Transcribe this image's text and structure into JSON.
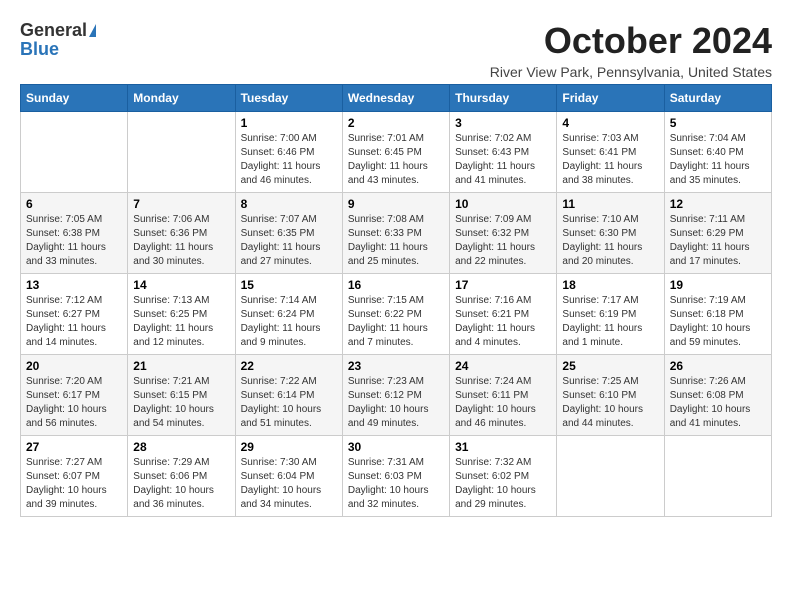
{
  "logo": {
    "general": "General",
    "blue": "Blue"
  },
  "title": "October 2024",
  "location": "River View Park, Pennsylvania, United States",
  "days_of_week": [
    "Sunday",
    "Monday",
    "Tuesday",
    "Wednesday",
    "Thursday",
    "Friday",
    "Saturday"
  ],
  "weeks": [
    [
      {
        "day": "",
        "sunrise": "",
        "sunset": "",
        "daylight": ""
      },
      {
        "day": "",
        "sunrise": "",
        "sunset": "",
        "daylight": ""
      },
      {
        "day": "1",
        "sunrise": "Sunrise: 7:00 AM",
        "sunset": "Sunset: 6:46 PM",
        "daylight": "Daylight: 11 hours and 46 minutes."
      },
      {
        "day": "2",
        "sunrise": "Sunrise: 7:01 AM",
        "sunset": "Sunset: 6:45 PM",
        "daylight": "Daylight: 11 hours and 43 minutes."
      },
      {
        "day": "3",
        "sunrise": "Sunrise: 7:02 AM",
        "sunset": "Sunset: 6:43 PM",
        "daylight": "Daylight: 11 hours and 41 minutes."
      },
      {
        "day": "4",
        "sunrise": "Sunrise: 7:03 AM",
        "sunset": "Sunset: 6:41 PM",
        "daylight": "Daylight: 11 hours and 38 minutes."
      },
      {
        "day": "5",
        "sunrise": "Sunrise: 7:04 AM",
        "sunset": "Sunset: 6:40 PM",
        "daylight": "Daylight: 11 hours and 35 minutes."
      }
    ],
    [
      {
        "day": "6",
        "sunrise": "Sunrise: 7:05 AM",
        "sunset": "Sunset: 6:38 PM",
        "daylight": "Daylight: 11 hours and 33 minutes."
      },
      {
        "day": "7",
        "sunrise": "Sunrise: 7:06 AM",
        "sunset": "Sunset: 6:36 PM",
        "daylight": "Daylight: 11 hours and 30 minutes."
      },
      {
        "day": "8",
        "sunrise": "Sunrise: 7:07 AM",
        "sunset": "Sunset: 6:35 PM",
        "daylight": "Daylight: 11 hours and 27 minutes."
      },
      {
        "day": "9",
        "sunrise": "Sunrise: 7:08 AM",
        "sunset": "Sunset: 6:33 PM",
        "daylight": "Daylight: 11 hours and 25 minutes."
      },
      {
        "day": "10",
        "sunrise": "Sunrise: 7:09 AM",
        "sunset": "Sunset: 6:32 PM",
        "daylight": "Daylight: 11 hours and 22 minutes."
      },
      {
        "day": "11",
        "sunrise": "Sunrise: 7:10 AM",
        "sunset": "Sunset: 6:30 PM",
        "daylight": "Daylight: 11 hours and 20 minutes."
      },
      {
        "day": "12",
        "sunrise": "Sunrise: 7:11 AM",
        "sunset": "Sunset: 6:29 PM",
        "daylight": "Daylight: 11 hours and 17 minutes."
      }
    ],
    [
      {
        "day": "13",
        "sunrise": "Sunrise: 7:12 AM",
        "sunset": "Sunset: 6:27 PM",
        "daylight": "Daylight: 11 hours and 14 minutes."
      },
      {
        "day": "14",
        "sunrise": "Sunrise: 7:13 AM",
        "sunset": "Sunset: 6:25 PM",
        "daylight": "Daylight: 11 hours and 12 minutes."
      },
      {
        "day": "15",
        "sunrise": "Sunrise: 7:14 AM",
        "sunset": "Sunset: 6:24 PM",
        "daylight": "Daylight: 11 hours and 9 minutes."
      },
      {
        "day": "16",
        "sunrise": "Sunrise: 7:15 AM",
        "sunset": "Sunset: 6:22 PM",
        "daylight": "Daylight: 11 hours and 7 minutes."
      },
      {
        "day": "17",
        "sunrise": "Sunrise: 7:16 AM",
        "sunset": "Sunset: 6:21 PM",
        "daylight": "Daylight: 11 hours and 4 minutes."
      },
      {
        "day": "18",
        "sunrise": "Sunrise: 7:17 AM",
        "sunset": "Sunset: 6:19 PM",
        "daylight": "Daylight: 11 hours and 1 minute."
      },
      {
        "day": "19",
        "sunrise": "Sunrise: 7:19 AM",
        "sunset": "Sunset: 6:18 PM",
        "daylight": "Daylight: 10 hours and 59 minutes."
      }
    ],
    [
      {
        "day": "20",
        "sunrise": "Sunrise: 7:20 AM",
        "sunset": "Sunset: 6:17 PM",
        "daylight": "Daylight: 10 hours and 56 minutes."
      },
      {
        "day": "21",
        "sunrise": "Sunrise: 7:21 AM",
        "sunset": "Sunset: 6:15 PM",
        "daylight": "Daylight: 10 hours and 54 minutes."
      },
      {
        "day": "22",
        "sunrise": "Sunrise: 7:22 AM",
        "sunset": "Sunset: 6:14 PM",
        "daylight": "Daylight: 10 hours and 51 minutes."
      },
      {
        "day": "23",
        "sunrise": "Sunrise: 7:23 AM",
        "sunset": "Sunset: 6:12 PM",
        "daylight": "Daylight: 10 hours and 49 minutes."
      },
      {
        "day": "24",
        "sunrise": "Sunrise: 7:24 AM",
        "sunset": "Sunset: 6:11 PM",
        "daylight": "Daylight: 10 hours and 46 minutes."
      },
      {
        "day": "25",
        "sunrise": "Sunrise: 7:25 AM",
        "sunset": "Sunset: 6:10 PM",
        "daylight": "Daylight: 10 hours and 44 minutes."
      },
      {
        "day": "26",
        "sunrise": "Sunrise: 7:26 AM",
        "sunset": "Sunset: 6:08 PM",
        "daylight": "Daylight: 10 hours and 41 minutes."
      }
    ],
    [
      {
        "day": "27",
        "sunrise": "Sunrise: 7:27 AM",
        "sunset": "Sunset: 6:07 PM",
        "daylight": "Daylight: 10 hours and 39 minutes."
      },
      {
        "day": "28",
        "sunrise": "Sunrise: 7:29 AM",
        "sunset": "Sunset: 6:06 PM",
        "daylight": "Daylight: 10 hours and 36 minutes."
      },
      {
        "day": "29",
        "sunrise": "Sunrise: 7:30 AM",
        "sunset": "Sunset: 6:04 PM",
        "daylight": "Daylight: 10 hours and 34 minutes."
      },
      {
        "day": "30",
        "sunrise": "Sunrise: 7:31 AM",
        "sunset": "Sunset: 6:03 PM",
        "daylight": "Daylight: 10 hours and 32 minutes."
      },
      {
        "day": "31",
        "sunrise": "Sunrise: 7:32 AM",
        "sunset": "Sunset: 6:02 PM",
        "daylight": "Daylight: 10 hours and 29 minutes."
      },
      {
        "day": "",
        "sunrise": "",
        "sunset": "",
        "daylight": ""
      },
      {
        "day": "",
        "sunrise": "",
        "sunset": "",
        "daylight": ""
      }
    ]
  ]
}
